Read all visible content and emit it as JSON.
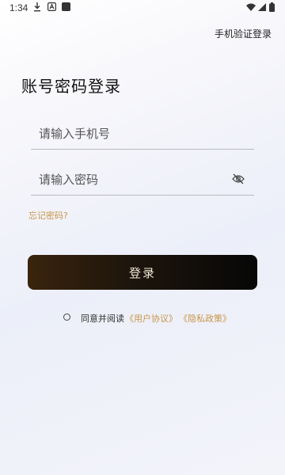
{
  "status_bar": {
    "time": "1:34",
    "icons": [
      "download-icon",
      "a-notification-icon",
      "app-notification-icon",
      "wifi-icon",
      "signal-icon",
      "battery-icon"
    ]
  },
  "header": {
    "switch_login_label": "手机验证登录"
  },
  "main": {
    "title": "账号密码登录",
    "phone_field": {
      "placeholder": "请输入手机号",
      "value": ""
    },
    "password_field": {
      "placeholder": "请输入密码",
      "value": "",
      "toggle_icon": "eye-off-icon"
    },
    "forgot_password_label": "忘记密码?",
    "login_button_label": "登录",
    "agreement": {
      "checked": false,
      "prefix": "同意并阅读",
      "user_agreement": "《用户协议》",
      "privacy_policy": "《隐私政策》"
    }
  },
  "colors": {
    "accent": "#c8964a",
    "button_dark": "#070707",
    "button_brown": "#3a240d",
    "button_text": "#f0e6d6"
  }
}
